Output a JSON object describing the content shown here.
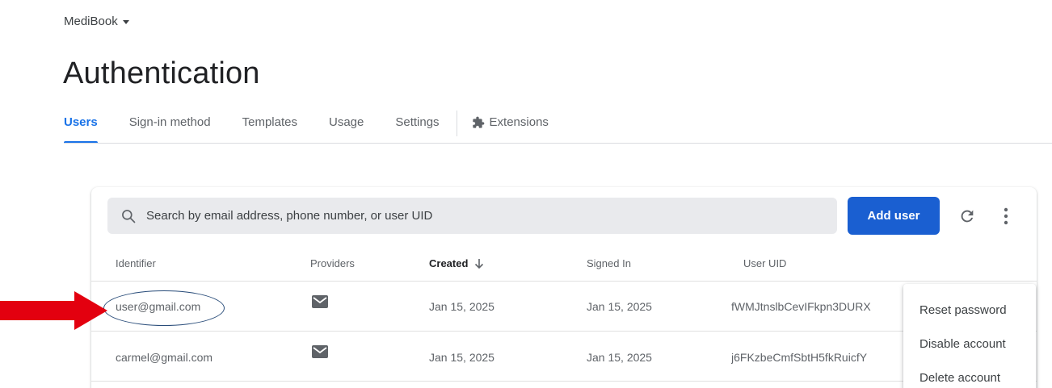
{
  "header": {
    "project_name": "MediBook",
    "page_title": "Authentication"
  },
  "tabs": [
    {
      "label": "Users",
      "active": true
    },
    {
      "label": "Sign-in method",
      "active": false
    },
    {
      "label": "Templates",
      "active": false
    },
    {
      "label": "Usage",
      "active": false
    },
    {
      "label": "Settings",
      "active": false
    },
    {
      "label": "Extensions",
      "active": false,
      "icon": "extension-puzzle-icon"
    }
  ],
  "toolbar": {
    "search_placeholder": "Search by email address, phone number, or user UID",
    "add_user_label": "Add user",
    "refresh_icon": "refresh-icon",
    "more_icon": "more-vert-icon"
  },
  "table": {
    "columns": [
      "Identifier",
      "Providers",
      "Created",
      "Signed In",
      "User UID"
    ],
    "sorted_column": "Created",
    "sort_direction": "descending",
    "rows": [
      {
        "identifier": "user@gmail.com",
        "provider_icon": "email-icon",
        "created": "Jan 15, 2025",
        "signed_in": "Jan 15, 2025",
        "uid": "fWMJtnslbCevIFkpn3DURX"
      },
      {
        "identifier": "carmel@gmail.com",
        "provider_icon": "email-icon",
        "created": "Jan 15, 2025",
        "signed_in": "Jan 15, 2025",
        "uid": "j6FKzbeCmfSbtH5fkRuicfY"
      }
    ]
  },
  "context_menu": {
    "items": [
      "Reset password",
      "Disable account",
      "Delete account"
    ]
  },
  "colors": {
    "accent": "#1a73e8",
    "button": "#1a5fd1",
    "annotation_arrow": "#e3000f",
    "annotation_ellipse": "#2a4d7a"
  }
}
